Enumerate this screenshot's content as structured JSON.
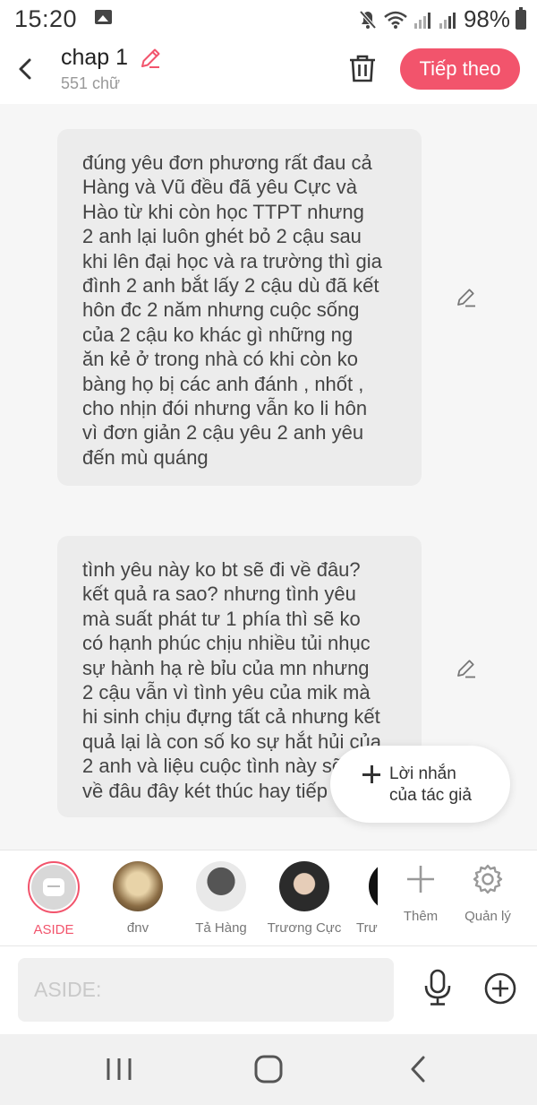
{
  "status_bar": {
    "time": "15:20",
    "battery": "98%",
    "icons": [
      "image-icon",
      "mute-icon",
      "wifi-icon",
      "signal-icon",
      "signal-icon",
      "battery-icon"
    ]
  },
  "header": {
    "title": "chap 1",
    "word_count": "551 chữ",
    "next_label": "Tiếp theo"
  },
  "messages": [
    {
      "text": "đúng yêu đơn phương rất đau cả\nHàng và Vũ đều đã yêu Cực và\nHào từ khi còn học TTPT nhưng\n2 anh lại luôn ghét bỏ 2 cậu  sau\nkhi lên đại học và ra trường thì gia\nđình 2 anh bắt lấy 2 cậu dù đã kết\nhôn đc 2 năm nhưng cuộc sống\ncủa 2 cậu ko khác gì những ng\năn kẻ ở trong nhà  có khi còn  ko\nbàng họ bị các anh đánh , nhốt ,\ncho nhịn đói nhưng vẫn ko li hôn\nvì đơn giản 2 cậu yêu 2 anh yêu\nđến mù quáng"
    },
    {
      "text": "tình yêu này ko bt sẽ đi về đâu?\nkết quả ra sao? nhưng tình yêu\nmà suất phát tư 1 phía thì sẽ ko\ncó hạnh phúc chịu nhiều tủi nhục\nsự hành hạ rè bỉu của mn nhưng\n2 cậu vẫn vì tình yêu của mik mà\nhi sinh chịu đựng tất cả nhưng kết\nquả lại là con số ko sự hắt hủi của\n2 anh và liệu cuộc tình này sẽ đi\nvề đâu đây két thúc hay tiếp tục"
    }
  ],
  "author_note": {
    "label": "Lời nhắn\ncủa tác giả"
  },
  "characters": [
    {
      "name": "ASIDE",
      "selected": true
    },
    {
      "name": "đnv"
    },
    {
      "name": "Tả Hàng"
    },
    {
      "name": "Trương Cực"
    },
    {
      "name": "Trươ"
    }
  ],
  "actions": {
    "add_label": "Thêm",
    "manage_label": "Quản lý"
  },
  "input": {
    "placeholder": "ASIDE:",
    "value": ""
  },
  "colors": {
    "accent": "#f2546c",
    "bubble": "#ececec",
    "background": "#f6f6f6"
  }
}
